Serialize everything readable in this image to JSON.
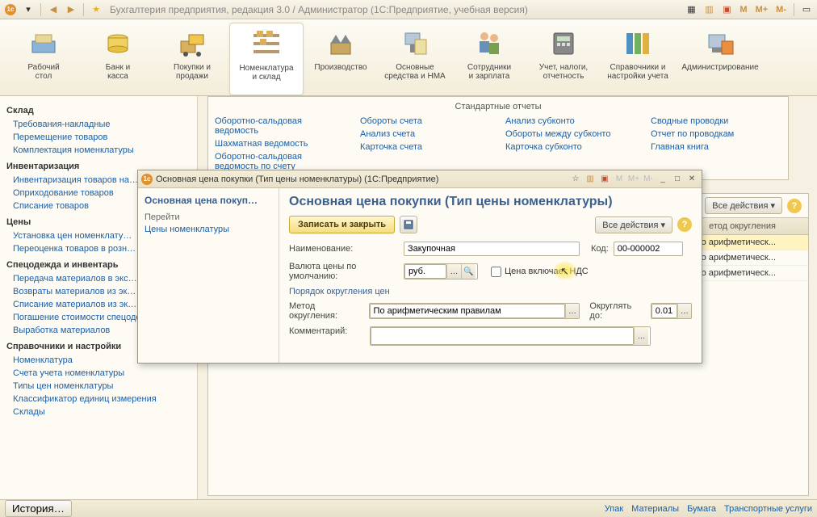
{
  "app_title": "Бухгалтерия предприятия, редакция 3.0 / Администратор   (1С:Предприятие, учебная версия)",
  "m_buttons": [
    "M",
    "M+",
    "M-"
  ],
  "ribbon": [
    {
      "label": "Рабочий\nстол"
    },
    {
      "label": "Банк и\nкасса"
    },
    {
      "label": "Покупки и\nпродажи"
    },
    {
      "label": "Номенклатура\nи склад"
    },
    {
      "label": "Производство"
    },
    {
      "label": "Основные\nсредства и НМА"
    },
    {
      "label": "Сотрудники\nи зарплата"
    },
    {
      "label": "Учет, налоги,\nотчетность"
    },
    {
      "label": "Справочники и\nнастройки учета"
    },
    {
      "label": "Администрирование"
    }
  ],
  "left_nav": [
    {
      "title": "Склад",
      "links": [
        "Требования-накладные",
        "Перемещение товаров",
        "Комплектация номенклатуры"
      ]
    },
    {
      "title": "Инвентаризация",
      "links": [
        "Инвентаризация товаров на…",
        "Оприходование товаров",
        "Списание товаров"
      ]
    },
    {
      "title": "Цены",
      "links": [
        "Установка цен номенклату…",
        "Переоценка товаров в розн…"
      ]
    },
    {
      "title": "Спецодежда и инвентарь",
      "links": [
        "Передача материалов в экс…",
        "Возвраты материалов из эк…",
        "Списание материалов из эк…",
        "Погашение стоимости спецодежды…",
        "Выработка материалов"
      ]
    },
    {
      "title": "Справочники и настройки",
      "links": [
        "Номенклатура",
        "Счета учета номенклатуры",
        "Типы цен номенклатуры",
        "Классификатор единиц измерения",
        "Склады"
      ]
    }
  ],
  "submenu": {
    "title": "Стандартные отчеты",
    "cols": [
      [
        "Оборотно-сальдовая ведомость",
        "Шахматная ведомость",
        "Оборотно-сальдовая ведомость по счету"
      ],
      [
        "Обороты счета",
        "Анализ счета",
        "Карточка счета"
      ],
      [
        "Анализ субконто",
        "Обороты между субконто",
        "Карточка субконто"
      ],
      [
        "Сводные проводки",
        "Отчет по проводкам",
        "Главная книга"
      ]
    ]
  },
  "list": {
    "all_actions": "Все действия",
    "header_col": "етод округления",
    "rows": [
      "о арифметическ...",
      "о арифметическ...",
      "о арифметическ..."
    ]
  },
  "modal": {
    "title": "Основная цена покупки (Тип цены номенклатуры)  (1С:Предприятие)",
    "left_title": "Основная цена покуп…",
    "left_grey": "Перейти",
    "left_link": "Цены номенклатуры",
    "main_title": "Основная цена покупки (Тип цены номенклатуры)",
    "write_close": "Записать и закрыть",
    "all_actions": "Все действия",
    "lbl_name": "Наименование:",
    "val_name": "Закупочная",
    "lbl_code": "Код:",
    "val_code": "00-000002",
    "lbl_currency": "Валюта цены по умолчанию:",
    "val_currency": "руб.",
    "lbl_vat": "Цена включает НДС",
    "section_round": "Порядок округления цен",
    "lbl_method": "Метод округления:",
    "val_method": "По арифметическим правилам",
    "lbl_roundto": "Округлять до:",
    "val_roundto": "0.01",
    "lbl_comment": "Комментарий:",
    "val_comment": ""
  },
  "status": {
    "history": "История…",
    "links": [
      "Упак",
      "Материалы",
      "Бумага",
      "Транспортные услуги"
    ]
  }
}
